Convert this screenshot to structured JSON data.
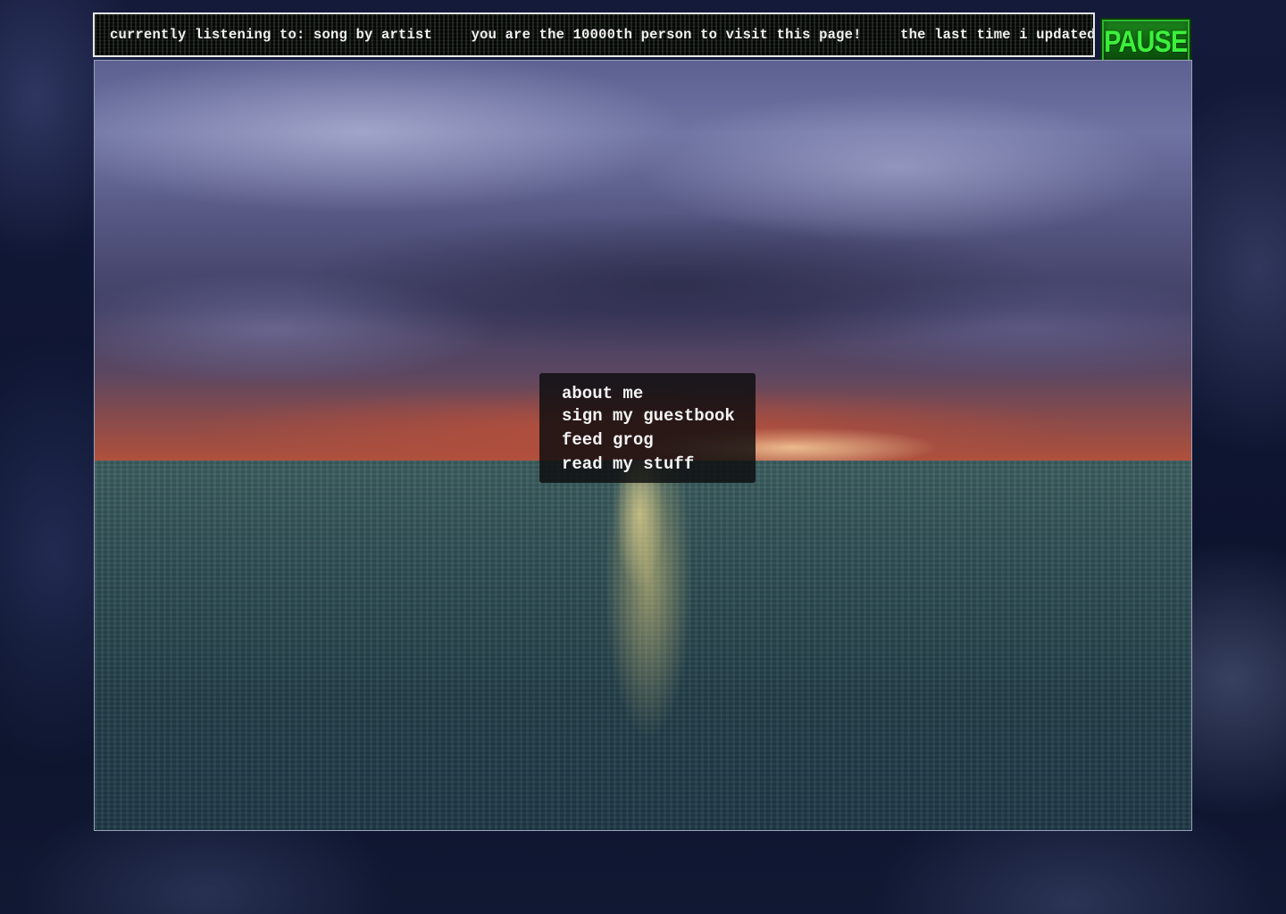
{
  "marquee": {
    "items": [
      "currently listening to: song by artist",
      "you are the 10000th person to visit this page!",
      "the last time i updated"
    ]
  },
  "pause_button": {
    "label": "PAUSE"
  },
  "nav": {
    "items": [
      {
        "label": "about me"
      },
      {
        "label": "sign my guestbook"
      },
      {
        "label": "feed grog"
      },
      {
        "label": "read my stuff"
      }
    ]
  },
  "colors": {
    "marquee_text": "#f2f2f2",
    "pause_green": "#3cf03c",
    "menu_bg": "#0c0c0e"
  }
}
